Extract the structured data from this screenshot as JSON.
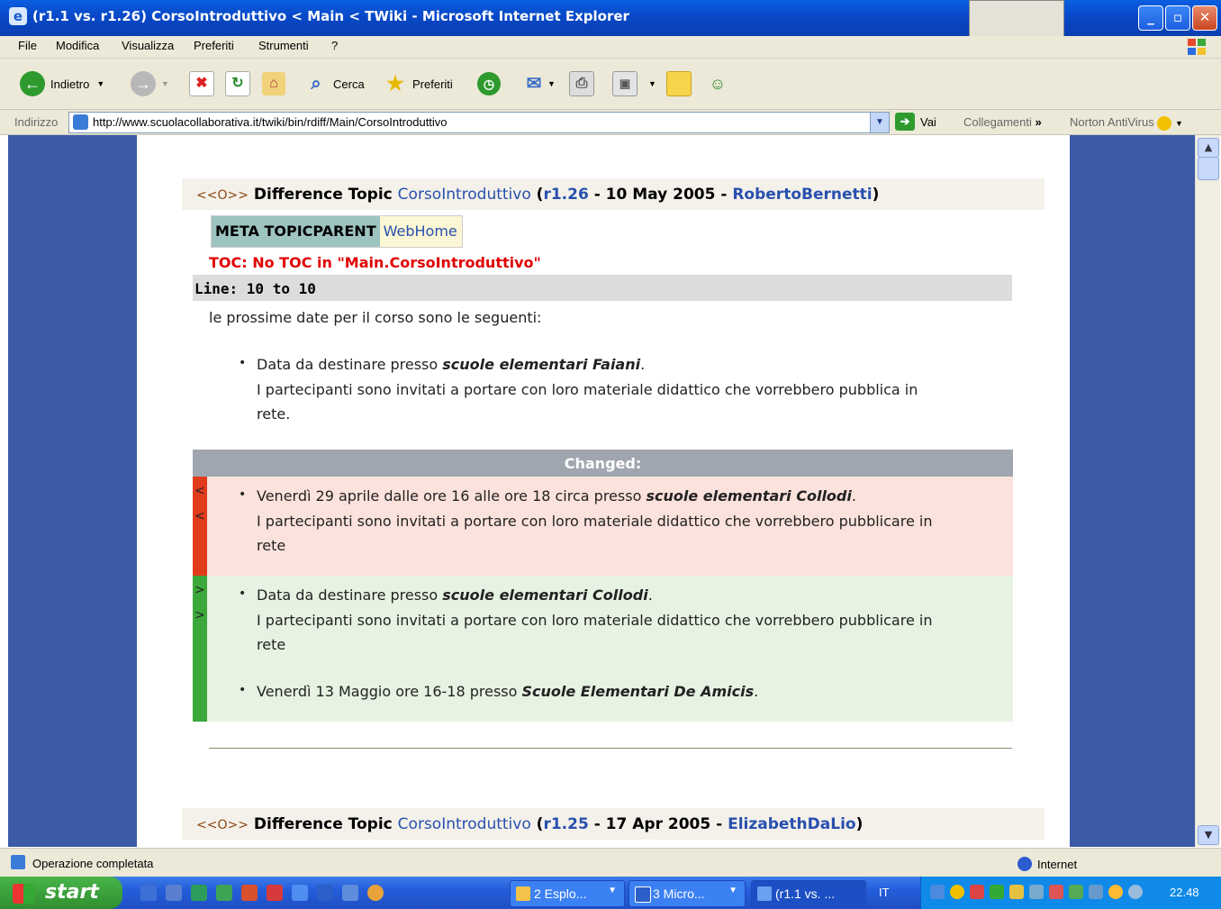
{
  "window": {
    "title": "(r1.1 vs. r1.26) CorsoIntroduttivo < Main < TWiki - Microsoft Internet Explorer"
  },
  "menu": [
    "File",
    "Modifica",
    "Visualizza",
    "Preferiti",
    "Strumenti",
    "?"
  ],
  "toolbar": {
    "back_label": "Indietro",
    "search_label": "Cerca",
    "favorites_label": "Preferiti",
    "icons": [
      "back-arrow-icon",
      "forward-arrow-icon",
      "stop-icon",
      "refresh-icon",
      "home-icon",
      "search-icon",
      "favorites-star-icon",
      "history-icon",
      "mail-icon",
      "print-icon",
      "edit-icon",
      "notes-icon",
      "messenger-icon"
    ]
  },
  "address": {
    "label": "Indirizzo",
    "url": "http://www.scuolacollaborativa.it/twiki/bin/rdiff/Main/CorsoIntroduttivo",
    "go_label": "Vai",
    "links_label": "Collegamenti",
    "links_chevron": "»",
    "norton_label": "Norton AntiVirus"
  },
  "content": {
    "diff1": {
      "nav": "<<O>>",
      "prefix": "Difference Topic",
      "topic": "CorsoIntroduttivo",
      "paren_open": "(",
      "rev": "r1.26",
      "date": "- 10 May 2005 -",
      "author": "RobertoBernetti",
      "paren_close": ")"
    },
    "meta_key": "META TOPICPARENT",
    "meta_value": "WebHome",
    "toc_error": "TOC: No TOC in \"Main.CorsoIntroduttivo\"",
    "line_label": "Line: 10 to 10",
    "intro": "le prossime date per il corso sono le seguenti:",
    "item1_prefix": "Data da destinare presso ",
    "item1_place": "scuole elementari Faiani",
    "item1_suffix": ".",
    "item1_line2": "I partecipanti sono invitati a portare con loro materiale didattico che vorrebbero pubblica in",
    "item1_line3": "rete.",
    "changed_label": "Changed:",
    "old_marker": "<",
    "old_prefix": "Venerdì 29 aprile dalle ore 16 alle ore 18 circa presso ",
    "old_place": "scuole elementari Collodi",
    "old_suffix": ".",
    "old_line2": "I partecipanti sono invitati a portare con loro materiale didattico che vorrebbero pubblicare in",
    "old_line3": "rete",
    "new_marker": ">",
    "new1_prefix": "Data da destinare presso ",
    "new1_place": "scuole elementari Collodi",
    "new1_suffix": ".",
    "new1_line2": "I partecipanti sono invitati a portare con loro materiale didattico che vorrebbero pubblicare in",
    "new1_line3": "rete",
    "new2_prefix": "Venerdì 13 Maggio ore 16-18 presso ",
    "new2_place": "Scuole Elementari De Amicis",
    "new2_suffix": ".",
    "diff2": {
      "nav": "<<O>>",
      "prefix": "Difference Topic",
      "topic": "CorsoIntroduttivo",
      "paren_open": "(",
      "rev": "r1.25",
      "date": "- 17 Apr 2005 -",
      "author": "ElizabethDaLio",
      "paren_close": ")"
    }
  },
  "status": {
    "text": "Operazione completata",
    "zone": "Internet"
  },
  "taskbar": {
    "start": "start",
    "tasks": [
      "2 Esplo...",
      "3 Micro...",
      "(r1.1 vs. ..."
    ],
    "lang": "IT",
    "clock": "22.48"
  }
}
